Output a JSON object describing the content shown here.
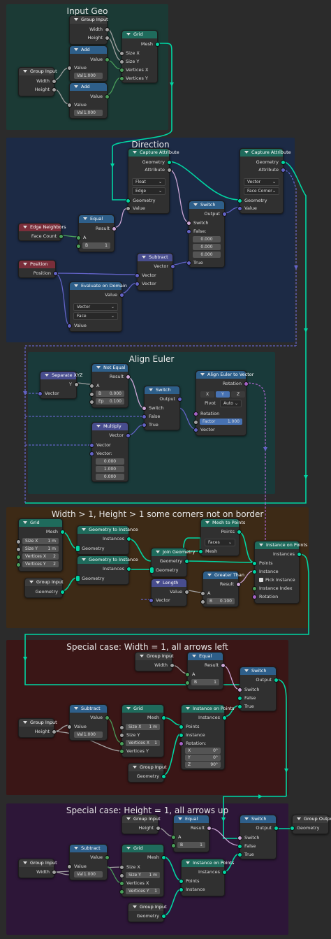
{
  "frames": {
    "input_geo": "Input Geo",
    "direction": "Direction",
    "align_euler": "Align Euler",
    "case_general": "Width > 1, Height > 1 some corners not on border",
    "case_width": "Special case: Width = 1, all arrows left",
    "case_height": "Special case: Height = 1, all arrows up"
  },
  "f1": {
    "group_input_top": {
      "title": "Group Input",
      "width": "Width",
      "height": "Height"
    },
    "grid": {
      "title": "Grid",
      "mesh": "Mesh",
      "size_x": "Size X",
      "size_y": "Size Y",
      "vertices_x": "Vertices X",
      "vertices_y": "Vertices Y"
    },
    "add1": {
      "title": "Add",
      "value": "Value",
      "value_in": "Value",
      "val": "Val",
      "val_num": "1.000"
    },
    "add2": {
      "title": "Add",
      "value": "Value",
      "value_in": "Value",
      "val": "Val",
      "val_num": "1.000"
    },
    "group_input_left": {
      "title": "Group Input",
      "width": "Width",
      "height": "Height"
    }
  },
  "f2": {
    "capture1": {
      "title": "Capture Attribute",
      "geometry": "Geometry",
      "attribute": "Attribute",
      "type": "Float",
      "domain": "Edge",
      "geometry_in": "Geometry",
      "value_in": "Value"
    },
    "capture2": {
      "title": "Capture Attribute",
      "geometry": "Geometry",
      "attribute": "Attribute",
      "type": "Vector",
      "domain": "Face Corner",
      "geometry_in": "Geometry",
      "value_in": "Value"
    },
    "edge_neighbors": {
      "title": "Edge Neighbors",
      "face_count": "Face Count"
    },
    "equal": {
      "title": "Equal",
      "result": "Result",
      "a": "A",
      "b": "B",
      "b_val": "1"
    },
    "switch": {
      "title": "Switch",
      "output": "Output",
      "switch": "Switch",
      "false": "False:",
      "true": "True",
      "v1": "0.000",
      "v2": "0.000",
      "v3": "0.000"
    },
    "position": {
      "title": "Position",
      "position": "Position"
    },
    "subtract": {
      "title": "Subtract",
      "vector": "Vector",
      "vector_a": "Vector",
      "vector_b": "Vector"
    },
    "eval_domain": {
      "title": "Evaluate on Domain",
      "value": "Value",
      "type": "Vector",
      "domain": "Face",
      "value_in": "Value"
    }
  },
  "f3": {
    "separate": {
      "title": "Separate XYZ",
      "y": "Y",
      "vector": "Vector"
    },
    "not_equal": {
      "title": "Not Equal",
      "result": "Result",
      "a": "A",
      "b": "B",
      "b_val": "0.000",
      "ep": "Ep",
      "ep_val": "0.100"
    },
    "switch": {
      "title": "Switch",
      "output": "Output",
      "switch": "Switch",
      "false": "False",
      "true": "True"
    },
    "align": {
      "title": "Align Euler to Vector",
      "rotation": "Rotation",
      "x": "X",
      "y": "Y",
      "z": "Z",
      "pivot": "Pivot",
      "pivot_val": "Auto",
      "rotation_in": "Rotation",
      "factor": "Factor",
      "factor_val": "1.000",
      "vector": "Vector"
    },
    "multiply": {
      "title": "Multiply",
      "vector": "Vector",
      "vector_a": "Vector",
      "vector_b": "Vector:",
      "v1": "0.000",
      "v2": "1.000",
      "v3": "0.000"
    }
  },
  "f4": {
    "grid": {
      "title": "Grid",
      "mesh": "Mesh",
      "size_x": "Size X",
      "size_x_val": "1 m",
      "size_y": "Size Y",
      "size_y_val": "1 m",
      "vx": "Vertices X",
      "vx_val": "2",
      "vy": "Vertices Y",
      "vy_val": "2"
    },
    "gti1": {
      "title": "Geometry to Instance",
      "instances": "Instances",
      "geometry": "Geometry"
    },
    "gti2": {
      "title": "Geometry to Instance",
      "instances": "Instances",
      "geometry": "Geometry"
    },
    "group_input": {
      "title": "Group Input",
      "geometry": "Geometry"
    },
    "mesh_to_points": {
      "title": "Mesh to Points",
      "points": "Points",
      "mode": "Faces",
      "mesh": "Mesh"
    },
    "join": {
      "title": "Join Geometry",
      "geometry": "Geometry",
      "geometry_in": "Geometry"
    },
    "length": {
      "title": "Length",
      "value": "Value",
      "vector": "Vector"
    },
    "greater": {
      "title": "Greater Than",
      "result": "Result",
      "a": "A",
      "b": "B",
      "b_val": "0.100"
    },
    "iop": {
      "title": "Instance on Points",
      "instances": "Instances",
      "points": "Points",
      "selection": "Selection",
      "instance": "Instance",
      "pick": "Pick Instance",
      "instance_index": "Instance Index",
      "rotation": "Rotation"
    }
  },
  "f5": {
    "group_input_top": {
      "title": "Group Input",
      "width": "Width"
    },
    "equal": {
      "title": "Equal",
      "result": "Result",
      "a": "A",
      "b": "B",
      "b_val": "1"
    },
    "switch": {
      "title": "Switch",
      "output": "Output",
      "switch": "Switch",
      "false": "False",
      "true": "True"
    },
    "group_input_left": {
      "title": "Group Input",
      "height": "Height"
    },
    "subtract": {
      "title": "Subtract",
      "value": "Value",
      "value_in": "Value",
      "val": "Val",
      "val_num": "1.000"
    },
    "grid": {
      "title": "Grid",
      "mesh": "Mesh",
      "size_x": "Size X",
      "size_x_val": "1 m",
      "size_y": "Size Y",
      "vx": "Vertices X",
      "vx_val": "1",
      "vy": "Vertices Y"
    },
    "iop": {
      "title": "Instance on Points",
      "instances": "Instances",
      "points": "Points",
      "instance": "Instance",
      "rotation": "Rotation:",
      "x": "X",
      "x_val": "0°",
      "y": "Y",
      "y_val": "0°",
      "z": "Z",
      "z_val": "90°"
    },
    "group_input_bottom": {
      "title": "Group Input",
      "geometry": "Geometry"
    }
  },
  "f6": {
    "group_input_top": {
      "title": "Group Input",
      "height": "Height"
    },
    "equal": {
      "title": "Equal",
      "result": "Result",
      "a": "A",
      "b": "B",
      "b_val": "1"
    },
    "switch": {
      "title": "Switch",
      "output": "Output",
      "switch": "Switch",
      "false": "False",
      "true": "True"
    },
    "group_output": {
      "title": "Group Output",
      "geometry": "Geometry"
    },
    "group_input_left": {
      "title": "Group Input",
      "width": "Width"
    },
    "subtract": {
      "title": "Subtract",
      "value": "Value",
      "value_in": "Value",
      "val": "Val",
      "val_num": "1.000"
    },
    "grid": {
      "title": "Grid",
      "mesh": "Mesh",
      "size_x": "Size X",
      "size_y": "Size Y",
      "size_y_val": "1 m",
      "vx": "Vertices X",
      "vy": "Vertices Y",
      "vy_val": "1"
    },
    "iop": {
      "title": "Instance on Points",
      "instances": "Instances",
      "points": "Points",
      "instance": "Instance"
    },
    "group_input_bottom": {
      "title": "Group Input",
      "geometry": "Geometry"
    }
  },
  "colors": {
    "geometry_wire": "#00d6a3",
    "float_wire": "#a1a1a1",
    "vector_wire": "#6363c7",
    "bool_wire": "#cca6d6",
    "int_wire": "#4a9f5a"
  }
}
